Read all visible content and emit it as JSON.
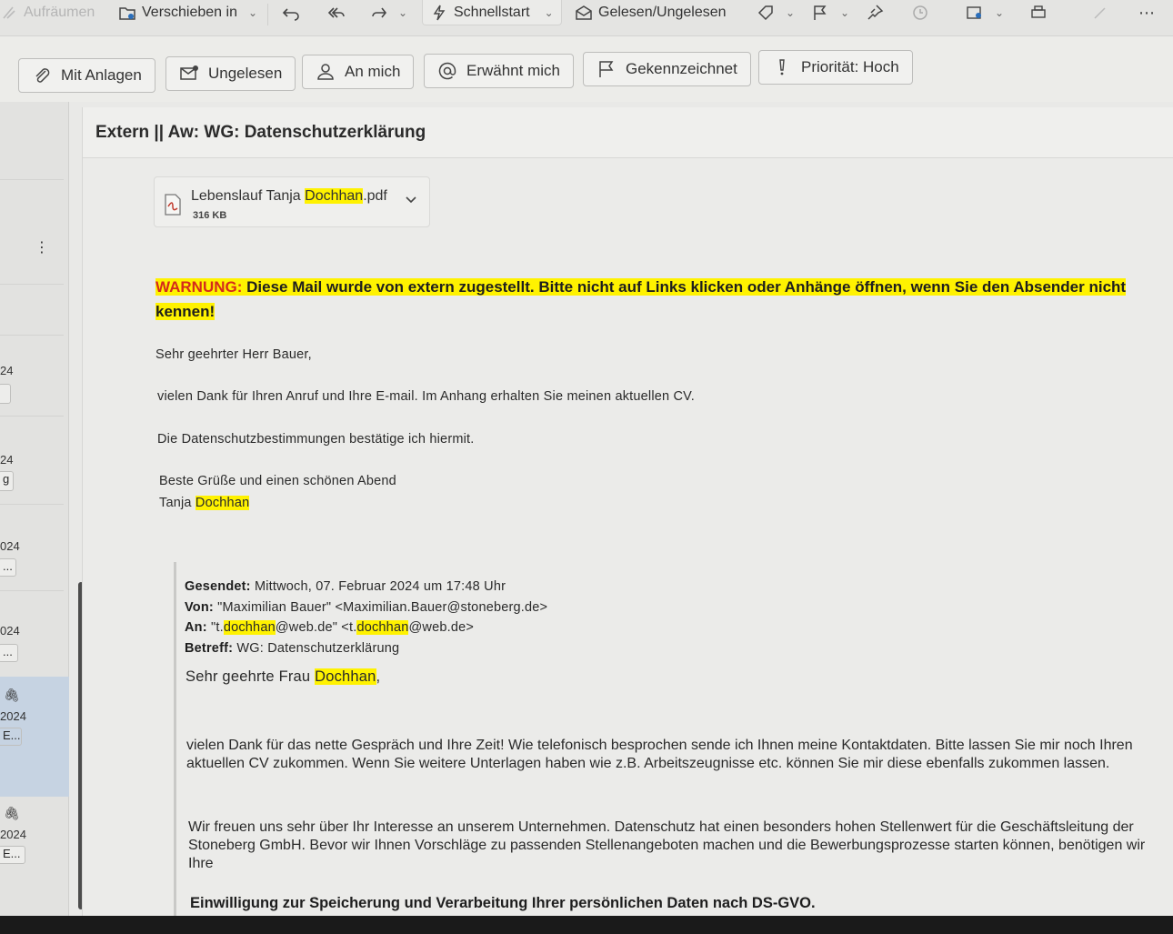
{
  "toolbar": {
    "cleanup_label": "Aufräumen",
    "move_label": "Verschieben in",
    "quickstart_label": "Schnellstart",
    "read_unread_label": "Gelesen/Ungelesen"
  },
  "filters": [
    {
      "label": "Mit Anlagen",
      "icon": "paperclip-icon"
    },
    {
      "label": "Ungelesen",
      "icon": "unread-mail-icon"
    },
    {
      "label": "An mich",
      "icon": "person-icon"
    },
    {
      "label": "Erwähnt mich",
      "icon": "at-sign-icon"
    },
    {
      "label": "Gekennzeichnet",
      "icon": "flag-icon"
    },
    {
      "label": "Priorität: Hoch",
      "icon": "exclamation-icon"
    }
  ],
  "list_column": {
    "dates": [
      "24",
      "24",
      "024",
      "024",
      "2024",
      "2024"
    ],
    "snippets": [
      "g",
      "...",
      "...",
      "E...",
      "E..."
    ]
  },
  "message": {
    "subject": "Extern || Aw: WG: Datenschutzerklärung",
    "attachment": {
      "name_prefix": "Lebenslauf Tanja ",
      "name_highlight": "Dochhan",
      "name_suffix": ".pdf",
      "size": "316 KB"
    },
    "warning_label": "WARNUNG:",
    "warning_text": " Diese Mail wurde von extern zugestellt. Bitte nicht auf Links klicken oder Anhänge öffnen, wenn Sie den Absender nicht kennen!",
    "greeting": "Sehr geehrter Herr Bauer,",
    "line1": "vielen Dank für Ihren Anruf und Ihre E-mail. Im Anhang erhalten Sie meinen aktuellen CV.",
    "line2": "Die Datenschutzbestimmungen bestätige ich hiermit.",
    "closing": "Beste Grüße und einen schönen Abend",
    "signature_first": "Tanja ",
    "signature_last": "Dochhan"
  },
  "quoted": {
    "sent_label": "Gesendet:",
    "sent_value": " Mittwoch, 07. Februar 2024 um 17:48 Uhr",
    "from_label": "Von:",
    "from_value": " \"Maximilian Bauer\" <Maximilian.Bauer@stoneberg.de>",
    "to_label": "An:",
    "to_1": " \"t.",
    "to_hl": "dochhan",
    "to_2": "@web.de\" <t.",
    "to_3": "@web.de>",
    "subject_label": "Betreff:",
    "subject_value": " WG: Datenschutzerklärung",
    "greeting_prefix": "Sehr geehrte Frau ",
    "greeting_name": "Dochhan",
    "greeting_suffix": ",",
    "para1": "vielen Dank für das nette Gespräch und Ihre Zeit! Wie telefonisch besprochen sende ich Ihnen meine Kontaktdaten. Bitte lassen Sie mir noch Ihren aktuellen CV zukommen. Wenn Sie weitere Unterlagen haben wie z.B. Arbeitszeugnisse etc. können Sie mir diese ebenfalls zukommen lassen.",
    "para2": "Wir freuen uns sehr über Ihr Interesse an unserem Unternehmen. Datenschutz hat einen besonders hohen Stellenwert für die Geschäftsleitung der Stoneberg GmbH. Bevor wir Ihnen Vorschläge zu passenden Stellenangeboten machen und die Bewerbungsprozesse starten können, benötigen wir Ihre",
    "consent_title": "Einwilligung zur Speicherung und Verarbeitung Ihrer persönlichen Daten nach DS-GVO."
  }
}
